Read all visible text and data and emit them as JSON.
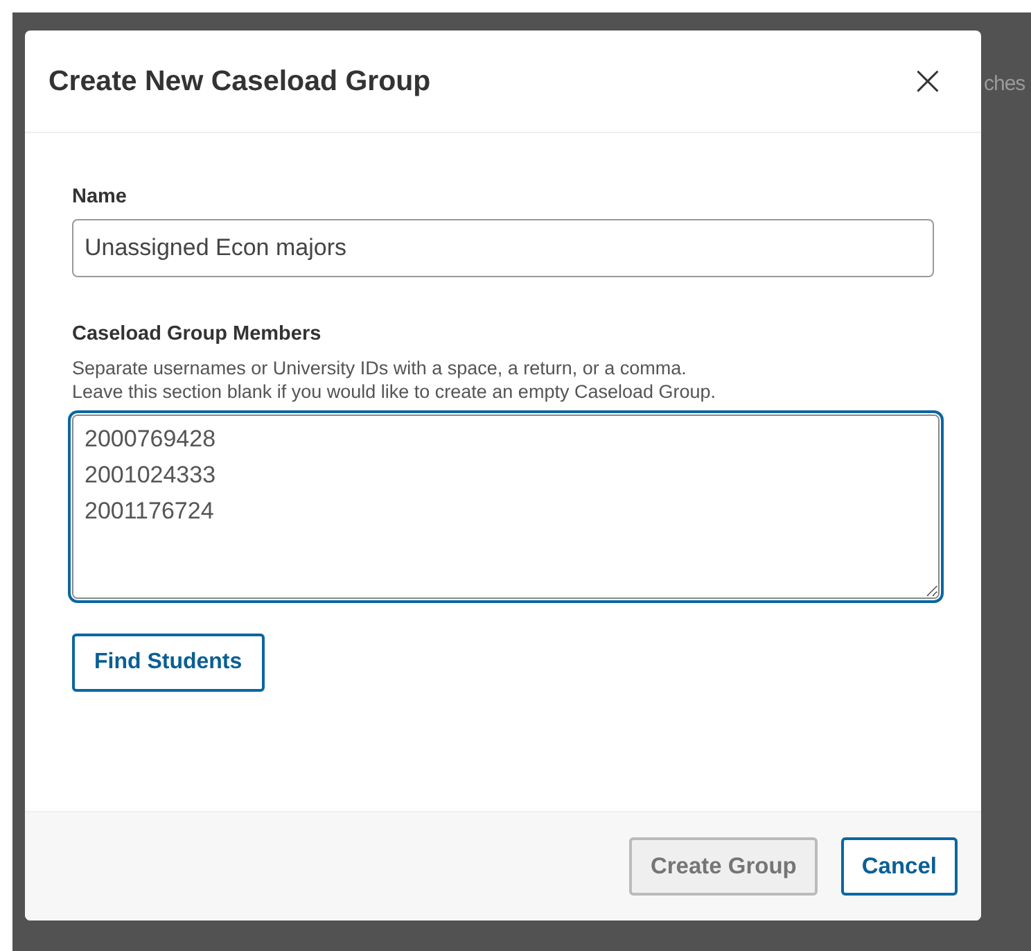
{
  "background": {
    "fragment": "ches"
  },
  "dialog": {
    "title": "Create New Caseload Group",
    "close": "×",
    "name_field": {
      "label": "Name",
      "value": "Unassigned Econ majors"
    },
    "members_field": {
      "label": "Caseload Group Members",
      "help": [
        "Separate usernames or University IDs with a space, a return, or a comma.",
        "Leave this section blank if you would like to create an empty Caseload Group."
      ],
      "lines": [
        "2000769428",
        "2001024333",
        "2001176724"
      ],
      "focused": true
    },
    "find_button": "Find Students",
    "buttons": [
      {
        "label": "Create Group",
        "disabled": true
      },
      {
        "label": "Cancel",
        "disabled": false
      }
    ]
  }
}
